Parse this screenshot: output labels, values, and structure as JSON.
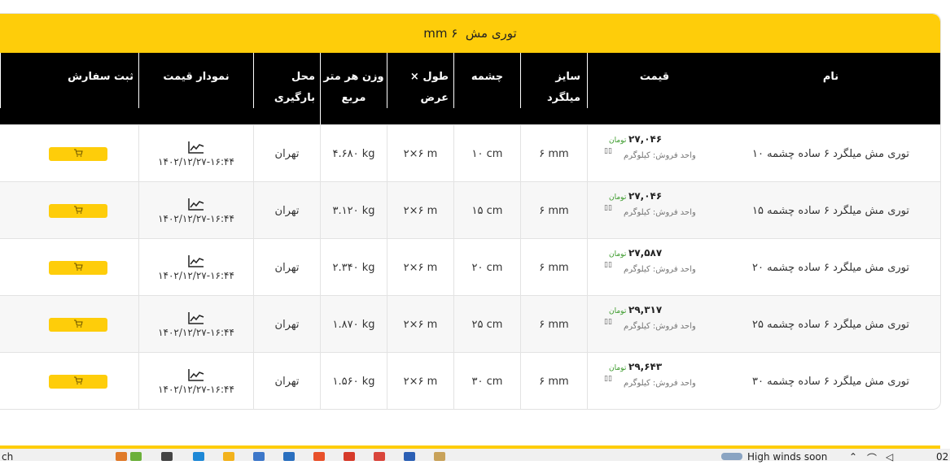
{
  "title": {
    "prefix": "توری مش",
    "size": "۶ mm"
  },
  "headers": {
    "name": "نام",
    "price": "قیمت",
    "wire_size": "سایز میلگرد",
    "mesh": "چشمه",
    "dimensions": "طول × عرض",
    "weight_line1": "وزن هر متر",
    "weight_line2": "مربع",
    "location": "محل بارگیری",
    "chart": "نمودار قیمت",
    "order": "ثبت سفارش"
  },
  "rows": [
    {
      "name": "توری مش میلگرد ۶ ساده چشمه ۱۰",
      "price": "۲۷,۰۴۶",
      "currency": "تومان",
      "sale_unit": "واحد فروش: کیلوگرم",
      "wire_size": "۶ mm",
      "mesh": "۱۰ cm",
      "dimensions": "۲×۶ m",
      "weight": "۴.۶۸۰ kg",
      "location": "تهران",
      "date": "۱۴۰۲/۱۲/۲۷-۱۶:۴۴"
    },
    {
      "name": "توری مش میلگرد ۶ ساده چشمه ۱۵",
      "price": "۲۷,۰۴۶",
      "currency": "تومان",
      "sale_unit": "واحد فروش: کیلوگرم",
      "wire_size": "۶ mm",
      "mesh": "۱۵ cm",
      "dimensions": "۲×۶ m",
      "weight": "۳.۱۲۰ kg",
      "location": "تهران",
      "date": "۱۴۰۲/۱۲/۲۷-۱۶:۴۴"
    },
    {
      "name": "توری مش میلگرد ۶ ساده چشمه ۲۰",
      "price": "۲۷,۵۸۷",
      "currency": "تومان",
      "sale_unit": "واحد فروش: کیلوگرم",
      "wire_size": "۶ mm",
      "mesh": "۲۰ cm",
      "dimensions": "۲×۶ m",
      "weight": "۲.۳۴۰ kg",
      "location": "تهران",
      "date": "۱۴۰۲/۱۲/۲۷-۱۶:۴۴"
    },
    {
      "name": "توری مش میلگرد ۶ ساده چشمه ۲۵",
      "price": "۲۹,۳۱۷",
      "currency": "تومان",
      "sale_unit": "واحد فروش: کیلوگرم",
      "wire_size": "۶ mm",
      "mesh": "۲۵ cm",
      "dimensions": "۲×۶ m",
      "weight": "۱.۸۷۰ kg",
      "location": "تهران",
      "date": "۱۴۰۲/۱۲/۲۷-۱۶:۴۴"
    },
    {
      "name": "توری مش میلگرد ۶ ساده چشمه ۳۰",
      "price": "۲۹,۶۴۳",
      "currency": "تومان",
      "sale_unit": "واحد فروش: کیلوگرم",
      "wire_size": "۶ mm",
      "mesh": "۳۰ cm",
      "dimensions": "۲×۶ m",
      "weight": "۱.۵۶۰ kg",
      "location": "تهران",
      "date": "۱۴۰۲/۱۲/۲۷-۱۶:۴۴"
    }
  ],
  "icons": {
    "chart": "line-chart-icon",
    "cart": "cart-icon",
    "unit": "unit-icon"
  },
  "colors": {
    "accent": "#fecd0a",
    "header_bg": "#000000",
    "currency": "#3a9a2a"
  },
  "taskbar": {
    "search_fragment": "ch",
    "weather": "High winds soon",
    "clock_fragment": "02"
  }
}
